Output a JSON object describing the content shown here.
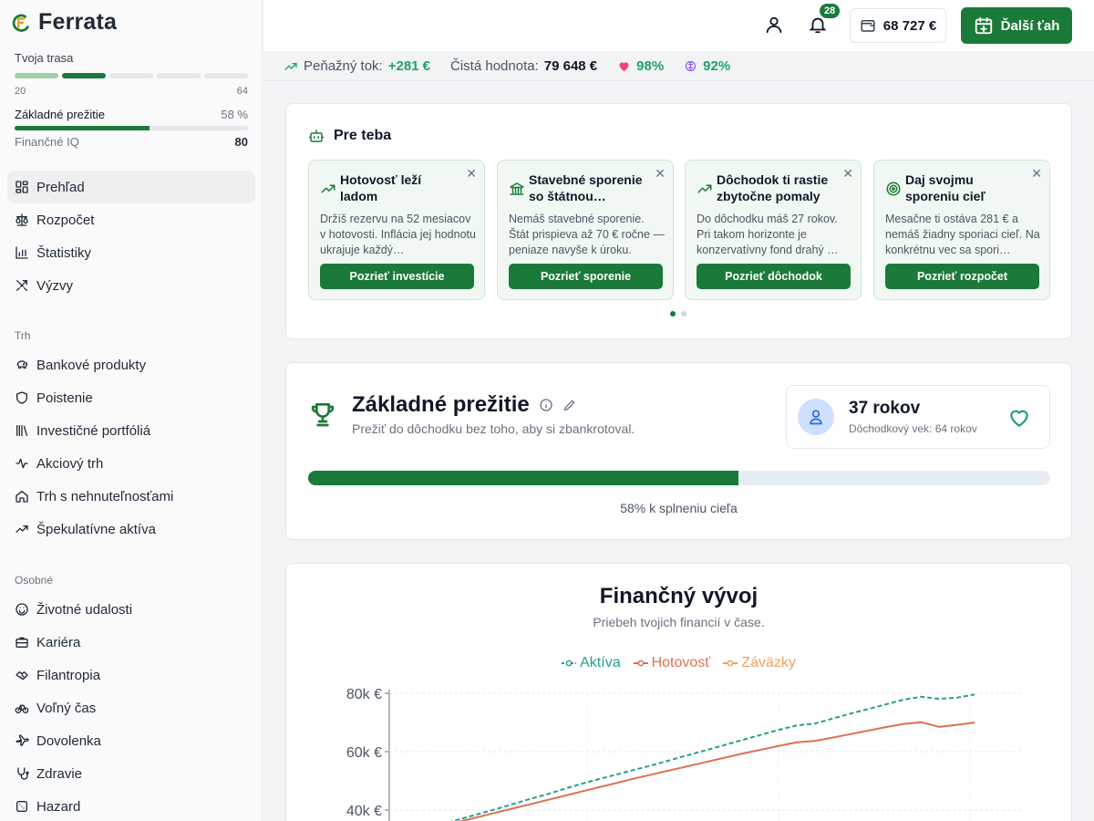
{
  "brand": {
    "name": "Ferrata"
  },
  "journey": {
    "label": "Tvoja trasa",
    "start": "20",
    "end": "64",
    "segments": [
      "done",
      "active",
      "todo",
      "todo",
      "todo"
    ]
  },
  "goal_mini": {
    "name": "Základné prežitie",
    "pct_label": "58 %",
    "progress": 0.58
  },
  "iq": {
    "label": "Finančné IQ",
    "value": "80"
  },
  "nav_main": [
    {
      "label": "Prehľad",
      "icon": "dashboard-icon",
      "active": true
    },
    {
      "label": "Rozpočet",
      "icon": "scale-icon"
    },
    {
      "label": "Štatistiky",
      "icon": "bar-chart-icon"
    },
    {
      "label": "Výzvy",
      "icon": "swords-icon"
    }
  ],
  "section_market": "Trh",
  "nav_market": [
    {
      "label": "Bankové produkty",
      "icon": "piggy-bank-icon"
    },
    {
      "label": "Poistenie",
      "icon": "shield-icon"
    },
    {
      "label": "Investičné portfóliá",
      "icon": "library-icon"
    },
    {
      "label": "Akciový trh",
      "icon": "activity-icon"
    },
    {
      "label": "Trh s nehnuteľnosťami",
      "icon": "house-icon"
    },
    {
      "label": "Špekulatívne aktíva",
      "icon": "trending-up-icon"
    }
  ],
  "section_personal": "Osobné",
  "nav_personal": [
    {
      "label": "Životné udalosti",
      "icon": "smile-icon"
    },
    {
      "label": "Kariéra",
      "icon": "briefcase-icon"
    },
    {
      "label": "Filantropia",
      "icon": "handshake-icon"
    },
    {
      "label": "Voľný čas",
      "icon": "bike-icon"
    },
    {
      "label": "Dovolenka",
      "icon": "plane-icon"
    },
    {
      "label": "Zdravie",
      "icon": "stethoscope-icon"
    },
    {
      "label": "Hazard",
      "icon": "dice-icon"
    }
  ],
  "topbar": {
    "notifications": "28",
    "wallet": "68 727 €",
    "next_turn": "Ďalší ťah"
  },
  "stats": {
    "cashflow_label": "Peňažný tok:",
    "cashflow_value": "+281 €",
    "networth_label": "Čistá hodnota:",
    "networth_value": "79 648 €",
    "health": "98%",
    "happiness": "92%"
  },
  "for_you": {
    "title": "Pre teba",
    "cards": [
      {
        "title": "Hotovosť leží ladom",
        "icon": "trending-up-icon",
        "desc": "Držíš rezervu na 52 mesiacov v hotovosti. Inflácia jej hodnotu ukrajuje každý…",
        "button": "Pozrieť investície"
      },
      {
        "title": "Stavebné sporenie so štátnou…",
        "icon": "bank-icon",
        "desc": "Nemáš stavebné sporenie. Štát prispieva až 70 € ročne — peniaze navyše k úroku.",
        "button": "Pozrieť sporenie"
      },
      {
        "title": "Dôchodok ti rastie zbytočne pomaly",
        "icon": "trending-up-icon",
        "desc": "Do dôchodku máš 27 rokov. Pri takom horizonte je konzervatívny fond drahý …",
        "button": "Pozrieť dôchodok"
      },
      {
        "title": "Daj svojmu sporeniu cieľ",
        "icon": "target-icon",
        "desc": "Mesačne ti ostáva 281 € a nemáš žiadny sporiaci cieľ. Na konkrétnu vec sa spori…",
        "button": "Pozrieť rozpočet"
      }
    ]
  },
  "goal": {
    "title": "Základné prežitie",
    "subtitle": "Prežiť do dôchodku bez toho, aby si zbankrotoval.",
    "age": "37 rokov",
    "retirement": "Dôchodkový vek: 64 rokov",
    "progress": 0.58,
    "caption": "58% k splneniu cieľa"
  },
  "chart_data": {
    "type": "line",
    "title": "Finančný vývoj",
    "subtitle": "Priebeh tvojich financií v čase.",
    "legend_position": "top",
    "y_ticks": [
      "80k €",
      "60k €",
      "40k €"
    ],
    "ylim": [
      30000,
      80000
    ],
    "grid": true,
    "series": [
      {
        "name": "Aktíva",
        "color": "#2a9d8f",
        "dash": true,
        "values": [
          35000,
          36800,
          38500,
          40200,
          42000,
          43800,
          45500,
          47400,
          49200,
          50800,
          52400,
          54000,
          55600,
          57300,
          59000,
          60700,
          62400,
          64100,
          65800,
          67500,
          69000,
          69600,
          71300,
          73000,
          74600,
          76200,
          77800,
          78800,
          78100,
          78500,
          79600
        ]
      },
      {
        "name": "Hotovosť",
        "color": "#e07052",
        "dash": false,
        "values": [
          34500,
          36000,
          37500,
          39000,
          40500,
          42000,
          43500,
          45000,
          46500,
          48000,
          49500,
          51000,
          52400,
          53800,
          55200,
          56600,
          58000,
          59400,
          60700,
          62000,
          63200,
          63700,
          64800,
          66000,
          67200,
          68400,
          69500,
          70100,
          68500,
          69200,
          70000
        ]
      },
      {
        "name": "Záväzky",
        "color": "#f0a060",
        "dash": false,
        "values": []
      }
    ]
  }
}
